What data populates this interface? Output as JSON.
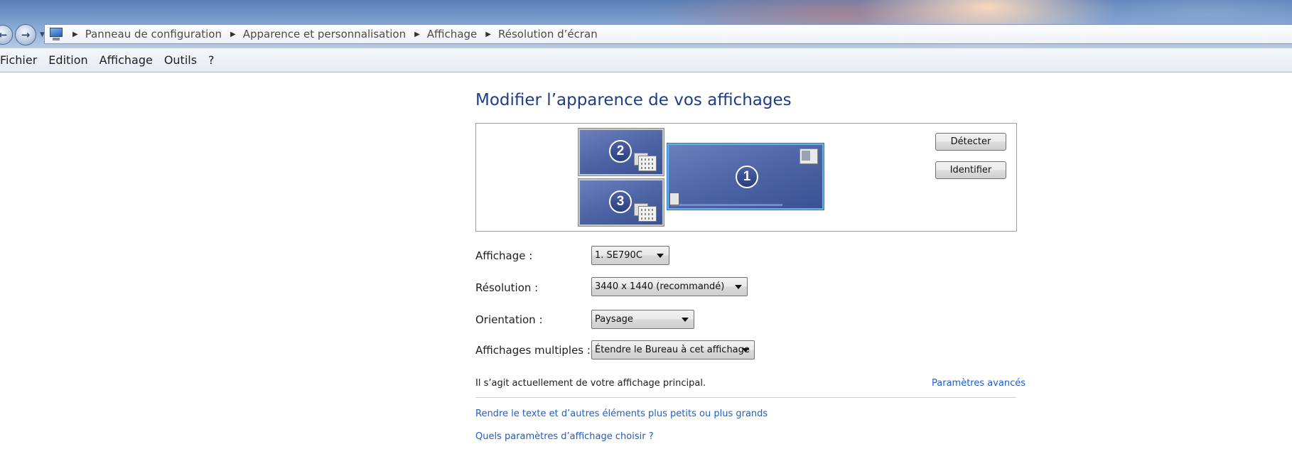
{
  "breadcrumb": {
    "items": [
      "Panneau de configuration",
      "Apparence et personnalisation",
      "Affichage",
      "Résolution d’écran"
    ]
  },
  "nav": {
    "back_icon": "back-arrow-icon",
    "forward_icon": "forward-arrow-icon",
    "dropdown_icon": "chevron-down-icon"
  },
  "menu": {
    "items": [
      "Fichier",
      "Edition",
      "Affichage",
      "Outils",
      "?"
    ]
  },
  "page": {
    "title": "Modifier l’apparence de vos affichages"
  },
  "monitors": [
    {
      "number": "1",
      "selected": true
    },
    {
      "number": "2",
      "selected": false
    },
    {
      "number": "3",
      "selected": false
    }
  ],
  "buttons": {
    "detect": "Détecter",
    "identify": "Identifier"
  },
  "settings": {
    "display_label": "Affichage :",
    "display_value": "1. SE790C",
    "resolution_label": "Résolution :",
    "resolution_value": "3440 x 1440 (recommandé)",
    "orientation_label": "Orientation :",
    "orientation_value": "Paysage",
    "multiple_label": "Affichages multiples :",
    "multiple_value": "Étendre le Bureau à cet affichage"
  },
  "status_text": "Il s’agit actuellement de votre affichage principal.",
  "links": {
    "advanced": "Paramètres avancés",
    "text_size": "Rendre le texte et d’autres éléments plus petits ou plus grands",
    "which_settings": "Quels paramètres d’affichage choisir ?"
  },
  "colors": {
    "heading": "#1e3c87",
    "link": "#1e5ec8",
    "monitor_fill": "#4b62a3",
    "selected_border": "#5ab4f0"
  }
}
